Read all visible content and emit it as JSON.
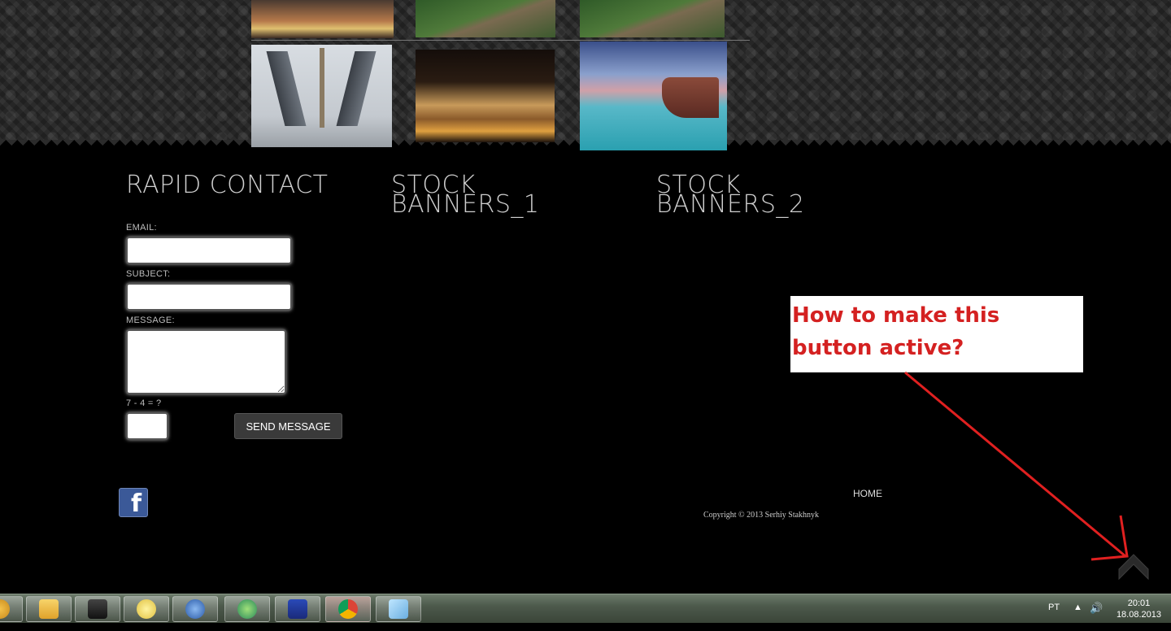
{
  "footer": {
    "rapid_contact": {
      "title": "RAPID CONTACT",
      "email_label": "EMAIL:",
      "subject_label": "SUBJECT:",
      "message_label": "MESSAGE:",
      "captcha_label": "7 - 4 = ?",
      "send_label": "SEND MESSAGE"
    },
    "stock_banners_1": {
      "title_line1": "STOCK",
      "title_line2": "BANNERS_1"
    },
    "stock_banners_2": {
      "title_line1": "STOCK",
      "title_line2": "BANNERS_2"
    },
    "nav_home": "HOME",
    "copyright": "Copyright © 2013 Serhiy Stakhnyk",
    "facebook_glyph": "f"
  },
  "annotation": {
    "line1": "How to make this",
    "line2": "button active?",
    "color": "#d42121"
  },
  "icons": {
    "scroll_top": "chevron-up-icon",
    "facebook": "facebook-icon"
  },
  "taskbar": {
    "language": "PT",
    "time": "20:01",
    "date": "18.08.2013",
    "apps": [
      "folder-icon",
      "camera-icon",
      "bulb-icon",
      "thunderbird-icon",
      "sync-icon",
      "floppy-icon",
      "chrome-icon",
      "notes-icon"
    ]
  }
}
